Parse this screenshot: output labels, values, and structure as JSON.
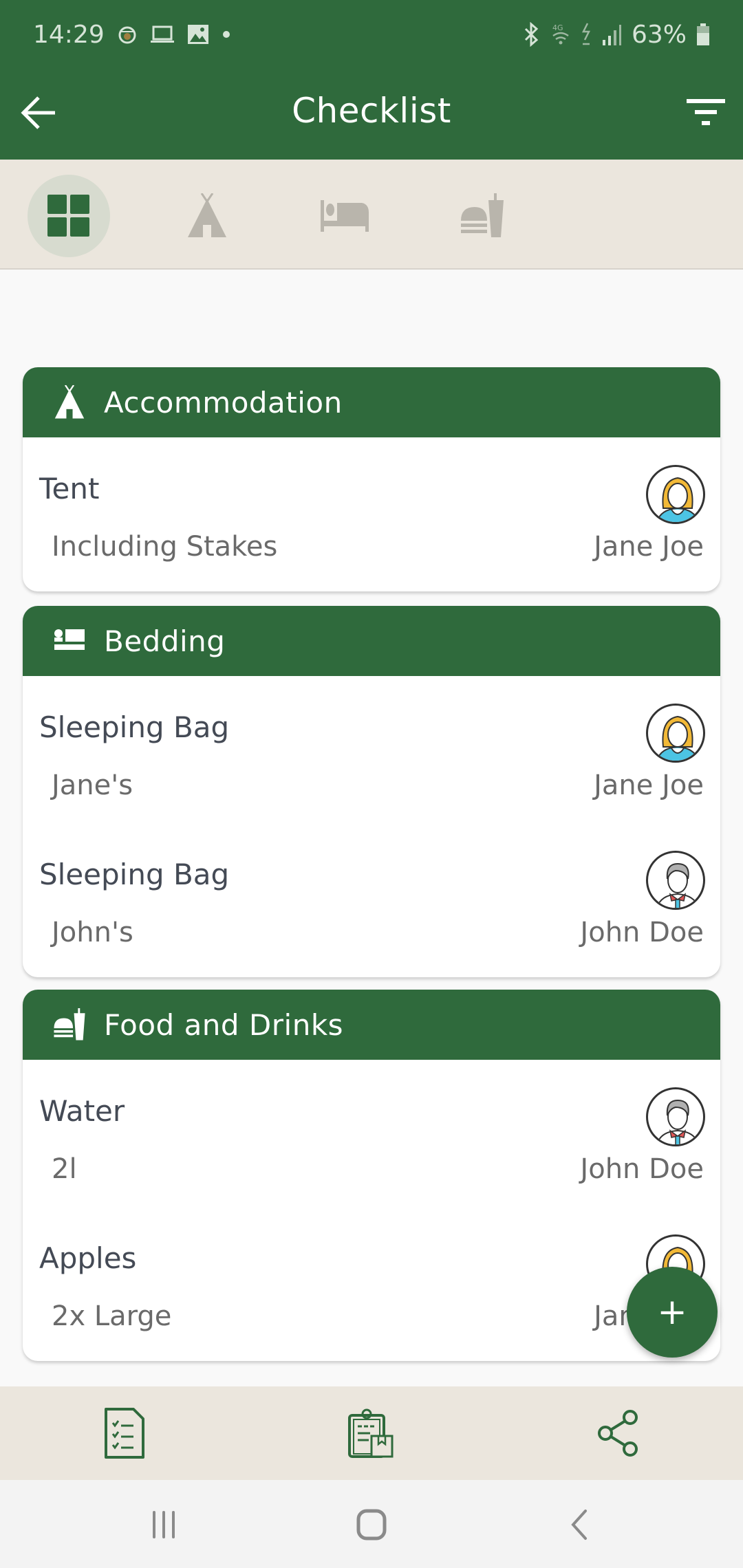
{
  "status_bar": {
    "time": "14:29",
    "battery": "63%",
    "network": "4G"
  },
  "app_bar": {
    "title": "Checklist"
  },
  "tabs": [
    {
      "id": "all",
      "icon": "grid-icon",
      "active": true
    },
    {
      "id": "accommodation",
      "icon": "tent-icon",
      "active": false
    },
    {
      "id": "bedding",
      "icon": "bed-icon",
      "active": false
    },
    {
      "id": "food",
      "icon": "food-icon",
      "active": false
    }
  ],
  "categories": [
    {
      "title": "Accommodation",
      "icon": "tent-icon",
      "items": [
        {
          "name": "Tent",
          "note": "Including Stakes",
          "person": "Jane Joe",
          "avatar": "female"
        }
      ]
    },
    {
      "title": "Bedding",
      "icon": "bed-icon",
      "items": [
        {
          "name": "Sleeping Bag",
          "note": "Jane's",
          "person": "Jane Joe",
          "avatar": "female"
        },
        {
          "name": "Sleeping Bag",
          "note": "John's",
          "person": "John Doe",
          "avatar": "male"
        }
      ]
    },
    {
      "title": "Food and Drinks",
      "icon": "food-icon",
      "items": [
        {
          "name": "Water",
          "note": "2l",
          "person": "John Doe",
          "avatar": "male"
        },
        {
          "name": "Apples",
          "note": "2x Large",
          "person": "Jane Joe",
          "avatar": "female"
        }
      ]
    }
  ],
  "fab": {
    "label": "+"
  },
  "bottom_bar": [
    {
      "name": "checklist-icon"
    },
    {
      "name": "clipboard-package-icon"
    },
    {
      "name": "share-icon"
    }
  ],
  "colors": {
    "primary": "#2f6a3c",
    "tab_bar_bg": "#ebe6dd",
    "inactive_icon": "#b9b5ac"
  }
}
